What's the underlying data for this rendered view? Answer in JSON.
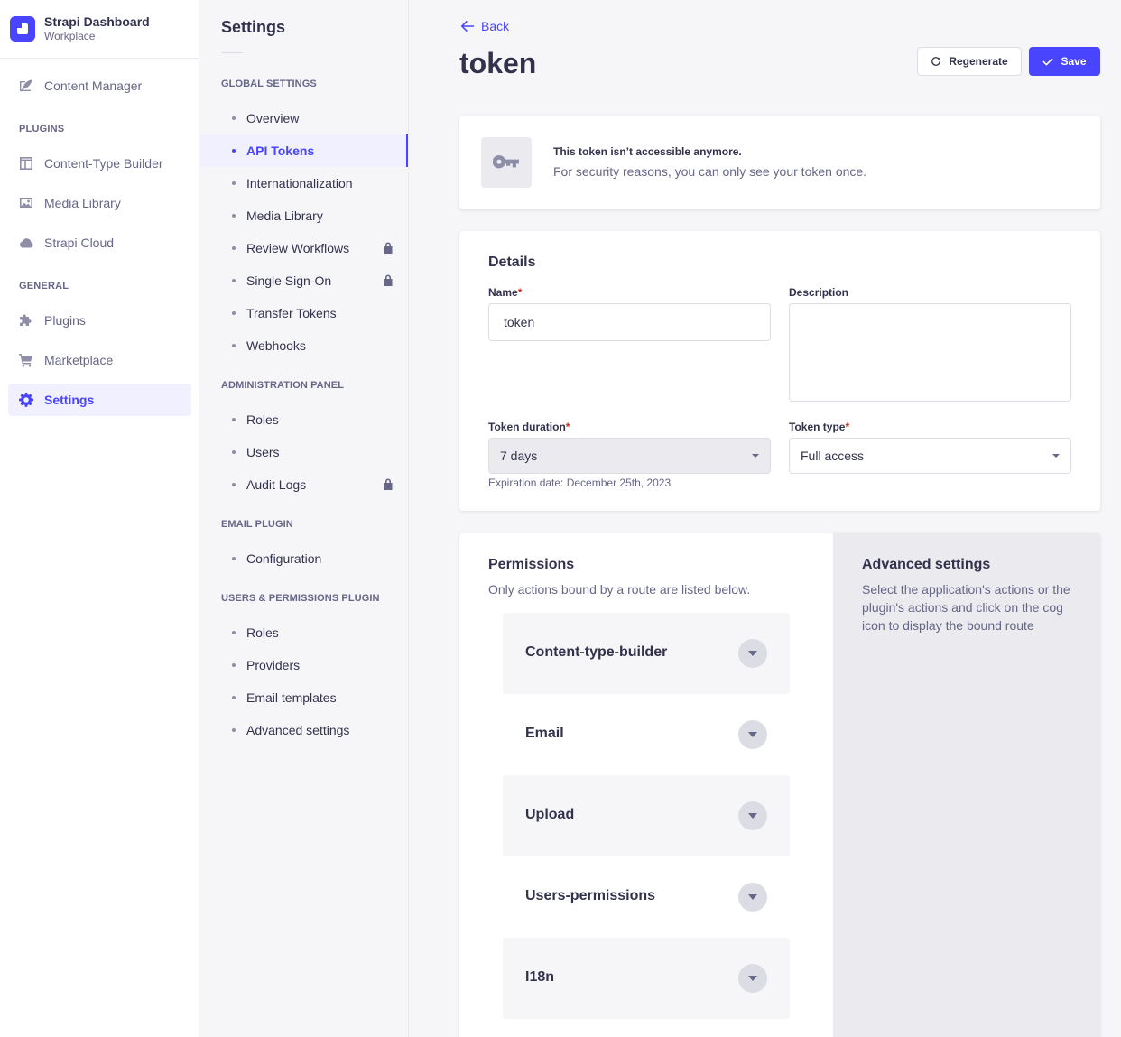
{
  "brand": {
    "title": "Strapi Dashboard",
    "subtitle": "Workplace"
  },
  "mainnav": {
    "content_manager": "Content Manager",
    "plugins_title": "PLUGINS",
    "content_type_builder": "Content-Type Builder",
    "media_library": "Media Library",
    "strapi_cloud": "Strapi Cloud",
    "general_title": "GENERAL",
    "plugins": "Plugins",
    "marketplace": "Marketplace",
    "settings": "Settings"
  },
  "subnav": {
    "title": "Settings",
    "global_title": "GLOBAL SETTINGS",
    "global_items": [
      "Overview",
      "API Tokens",
      "Internationalization",
      "Media Library",
      "Review Workflows",
      "Single Sign-On",
      "Transfer Tokens",
      "Webhooks"
    ],
    "admin_title": "ADMINISTRATION PANEL",
    "admin_items": [
      "Roles",
      "Users",
      "Audit Logs"
    ],
    "email_title": "EMAIL PLUGIN",
    "email_items": [
      "Configuration"
    ],
    "users_title": "USERS & PERMISSIONS PLUGIN",
    "users_items": [
      "Roles",
      "Providers",
      "Email templates",
      "Advanced settings"
    ]
  },
  "header": {
    "back": "Back",
    "title": "token",
    "regenerate": "Regenerate",
    "save": "Save"
  },
  "alert": {
    "title": "This token isn’t accessible anymore.",
    "text": "For security reasons, you can only see your token once."
  },
  "details": {
    "title": "Details",
    "name_label": "Name",
    "name_value": "token",
    "description_label": "Description",
    "duration_label": "Token duration",
    "duration_value": "7 days",
    "expiration": "Expiration date: December 25th, 2023",
    "type_label": "Token type",
    "type_value": "Full access",
    "required_mark": "*"
  },
  "permissions": {
    "title": "Permissions",
    "subtitle": "Only actions bound by a route are listed below.",
    "groups": [
      "Content-type-builder",
      "Email",
      "Upload",
      "Users-permissions",
      "I18n"
    ]
  },
  "advanced": {
    "title": "Advanced settings",
    "text": "Select the application's actions or the plugin's actions and click on the cog icon to display the bound route"
  },
  "colors": {
    "primary": "#4945ff",
    "required": "#d02b20",
    "text": "#32324d",
    "muted": "#666687"
  }
}
